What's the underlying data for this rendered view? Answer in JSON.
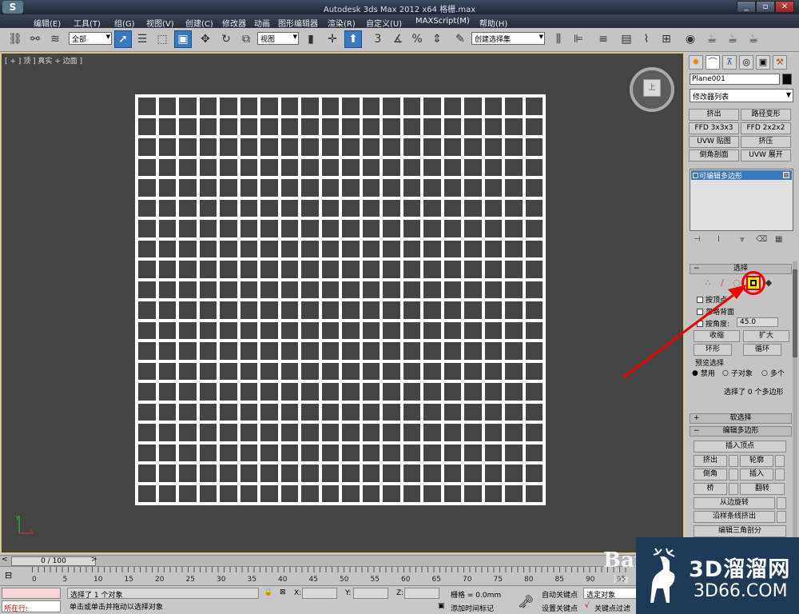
{
  "titlebar": {
    "title": "Autodesk 3ds Max  2012 x64    格栅.max",
    "min": "_",
    "max": "▫",
    "close": "✕"
  },
  "menu": [
    "编辑(E)",
    "工具(T)",
    "组(G)",
    "视图(V)",
    "创建(C)",
    "修改器",
    "动画",
    "图形编辑器",
    "渲染(R)",
    "自定义(U)",
    "MAXScript(M)",
    "帮助(H)"
  ],
  "toolbar": {
    "selection_filter": "全部",
    "ref_coord": "视图",
    "named_selection": "创建选择集"
  },
  "viewport": {
    "label": "[ + ] 顶 ] 真实 + 边面 ]",
    "viewcube_face": "上"
  },
  "grid": {
    "rows": 20,
    "cols": 20
  },
  "panel": {
    "object_name": "Plane001",
    "object_color": "#0a0a0a",
    "modifier_list": "修改器列表",
    "modifier_buttons": [
      "挤出",
      "路径变形",
      "FFD 3x3x3",
      "FFD 2x2x2",
      "UVW 贴图",
      "挤压",
      "倒角剖面",
      "UVW 展开"
    ],
    "stack_item": "可编辑多边形",
    "selection": {
      "header": "选择",
      "by_vertex": "按顶点",
      "ignore_backfacing": "忽略背面",
      "by_angle": "按角度:",
      "angle_value": "45.0",
      "shrink": "收缩",
      "grow": "扩大",
      "ring": "环形",
      "loop": "循环",
      "preview_header": "预览选择",
      "preview_options": [
        "禁用",
        "子对象",
        "多个"
      ],
      "selected_text": "选择了 0 个多边形"
    },
    "soft_selection": "软选择",
    "edit_poly": {
      "header": "编辑多边形",
      "insert_vertex": "插入顶点",
      "extrude": "挤出",
      "outline": "轮廓",
      "bevel": "倒角",
      "inset": "插入",
      "bridge": "桥",
      "flip": "翻转",
      "hinge": "从边旋转",
      "extrude_spline": "沿样条线挤出",
      "edit_tri": "编辑三角剖分"
    }
  },
  "timeslider": {
    "label": "0 / 100"
  },
  "trackbar": {
    "ticks": [
      "0",
      "5",
      "10",
      "15",
      "20",
      "25",
      "30",
      "35",
      "40",
      "45",
      "50",
      "55",
      "60",
      "65",
      "70",
      "75",
      "80",
      "85",
      "90",
      "95"
    ]
  },
  "status": {
    "listener": "所在行:",
    "status_top": "选择了 1 个对象",
    "status_bottom": "单击或单击并拖动以选择对象",
    "x_label": "X:",
    "y_label": "Y:",
    "z_label": "Z:",
    "grid": "栅格 = 0.0mm",
    "add_time_tag": "添加时间标记",
    "auto_key": "自动关键点",
    "set_key": "设置关键点",
    "selected_dropdown": "选定对象",
    "key_filter": "关键点过滤"
  },
  "watermark": {
    "brand": "3D溜溜网",
    "domain": "3D66.COM",
    "baidu": "Bai",
    "baidu_sub": "jing"
  }
}
